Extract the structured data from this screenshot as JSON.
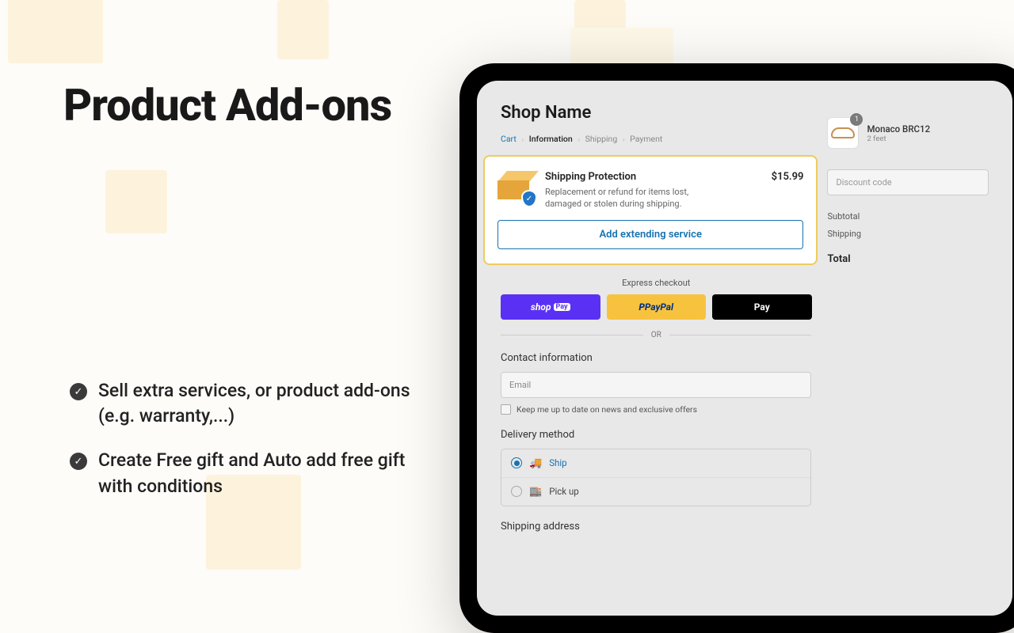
{
  "headline": "Product Add-ons",
  "features": [
    "Sell extra services, or product add-ons (e.g. warranty,...)",
    "Create Free gift and Auto add free gift with conditions"
  ],
  "checkout": {
    "shop_name": "Shop Name",
    "breadcrumbs": {
      "cart": "Cart",
      "information": "Information",
      "shipping": "Shipping",
      "payment": "Payment"
    },
    "addon": {
      "title": "Shipping Protection",
      "desc": "Replacement or refund for items lost, damaged or stolen during shipping.",
      "price": "$15.99",
      "button": "Add extending service"
    },
    "express_label": "Express checkout",
    "paypal_label": "PayPal",
    "applepay_label": "Pay",
    "or": "OR",
    "contact_heading": "Contact information",
    "email_placeholder": "Email",
    "newsletter": "Keep me up to date on news and exclusive offers",
    "delivery_heading": "Delivery method",
    "ship": "Ship",
    "pickup": "Pick up",
    "shipping_address_heading": "Shipping address"
  },
  "summary": {
    "item_name": "Monaco BRC12",
    "item_sub": "2 feet",
    "item_qty": "1",
    "discount_placeholder": "Discount code",
    "subtotal_label": "Subtotal",
    "shipping_label": "Shipping",
    "total_label": "Total"
  }
}
